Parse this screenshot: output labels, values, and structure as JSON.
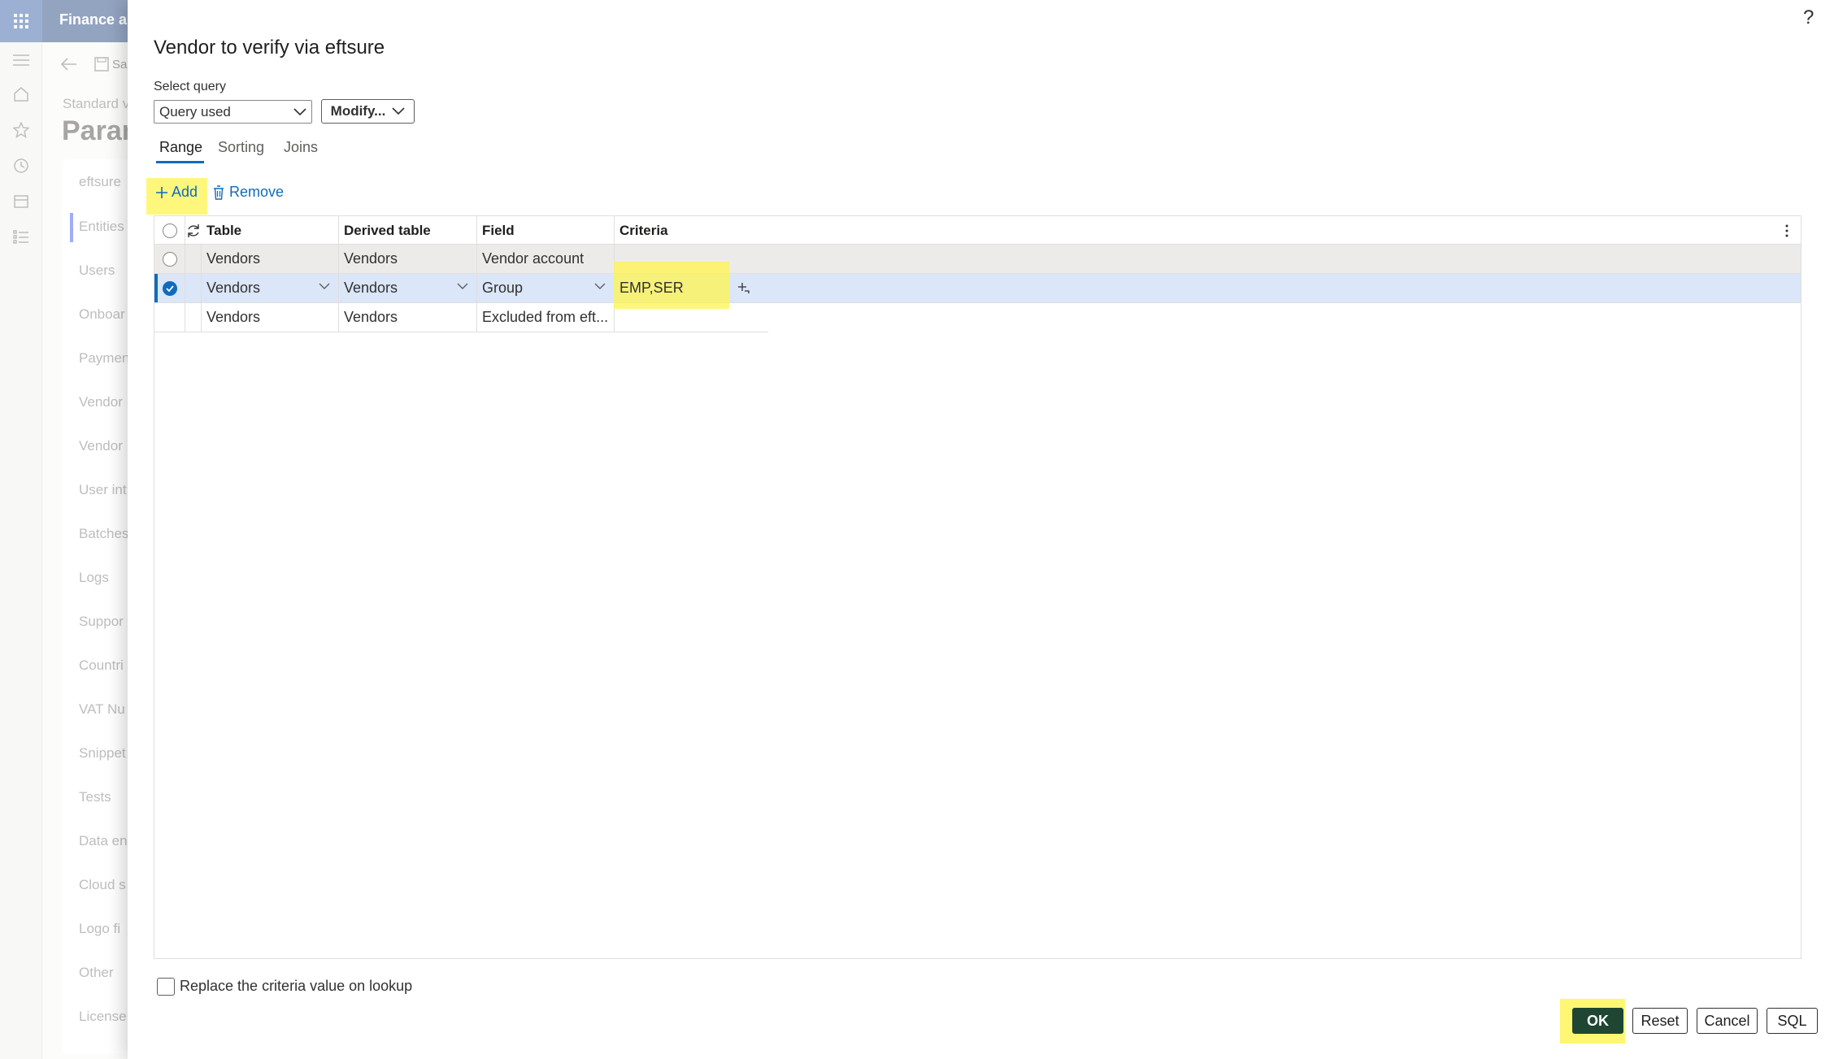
{
  "app": {
    "title": "Finance an",
    "save_label": "Sa",
    "breadcrumb": "Standard v",
    "heading": "Paran",
    "side_items": [
      "eftsure",
      "Entities",
      "Users",
      "Onboar",
      "Paymen",
      "Vendor",
      "Vendor",
      "User int",
      "Batches",
      "Logs",
      "Suppor",
      "Countri",
      "VAT Nu",
      "Snippet",
      "Tests",
      "Data en",
      "Cloud s",
      "Logo fi",
      "Other",
      "License"
    ]
  },
  "dialog": {
    "title": "Vendor to verify via eftsure",
    "help": "?",
    "select_query_label": "Select query",
    "query_value": "Query used",
    "modify_label": "Modify...",
    "tabs": [
      "Range",
      "Sorting",
      "Joins"
    ],
    "add_label": "Add",
    "remove_label": "Remove",
    "columns": [
      "Table",
      "Derived table",
      "Field",
      "Criteria"
    ],
    "rows": [
      {
        "table": "Vendors",
        "derived": "Vendors",
        "field": "Vendor account",
        "criteria": "",
        "selected": false
      },
      {
        "table": "Vendors",
        "derived": "Vendors",
        "field": "Group",
        "criteria": "EMP,SER",
        "selected": true
      },
      {
        "table": "Vendors",
        "derived": "Vendors",
        "field": "Excluded from eft...",
        "criteria": "",
        "selected": false
      }
    ],
    "replace_label": "Replace the criteria value on lookup",
    "buttons": {
      "ok": "OK",
      "reset": "Reset",
      "cancel": "Cancel",
      "sql": "SQL"
    }
  },
  "colors": {
    "accent": "#0f6cbd",
    "highlight": "#fff44f",
    "ok_bg": "#1e4632",
    "selected_row": "#dbe6f8"
  }
}
